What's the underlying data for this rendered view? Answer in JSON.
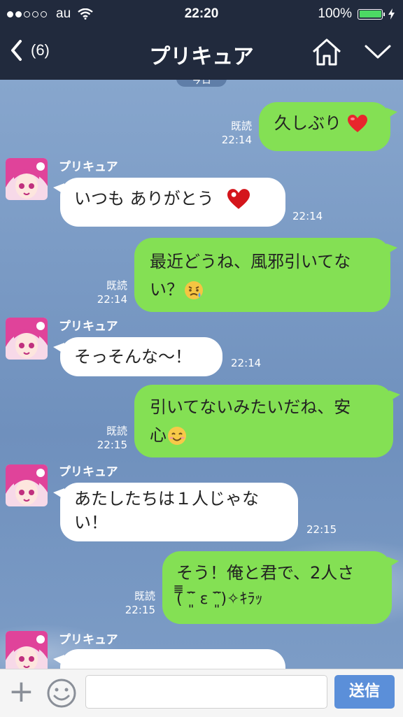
{
  "status_bar": {
    "carrier": "au",
    "time": "22:20",
    "battery": "100%"
  },
  "nav": {
    "back_count": "(6)",
    "title": "プリキュア"
  },
  "date_separator": "今日",
  "messages": [
    {
      "dir": "out",
      "text": "久しぶり",
      "emoji": "heart-icon",
      "read": "既読",
      "time": "22:14"
    },
    {
      "dir": "in",
      "sender": "プリキュア",
      "text": "いつも ありがとう",
      "emoji": "heart-icon",
      "time": "22:14"
    },
    {
      "dir": "out",
      "line1": "最近どうね、風邪引いてな",
      "line2": "い？",
      "emoji": "worried-face-icon",
      "read": "既読",
      "time": "22:14"
    },
    {
      "dir": "in",
      "sender": "プリキュア",
      "text": "そっそんな〜！",
      "time": "22:14"
    },
    {
      "dir": "out",
      "line1": "引いてないみたいだね、安",
      "line2": "心",
      "emoji": "smiling-face-icon",
      "read": "既読",
      "time": "22:15"
    },
    {
      "dir": "in",
      "sender": "プリキュア",
      "line1": "あたしたちは１人じゃな",
      "line2": "い！",
      "time": "22:15"
    },
    {
      "dir": "out",
      "line1": "そう！俺と君で、2人さ",
      "line2": "(̅̅̅̅ ‾͈̑ ε ‾͈̑)✧ｷﾗｯ",
      "read": "既読",
      "time": "22:15"
    },
    {
      "dir": "in",
      "sender": "プリキュア"
    }
  ],
  "input": {
    "placeholder": "",
    "send_label": "送信"
  },
  "colors": {
    "header": "#212a3d",
    "outgoing": "#84e054",
    "incoming": "#ffffff",
    "send": "#5b8fd9"
  }
}
